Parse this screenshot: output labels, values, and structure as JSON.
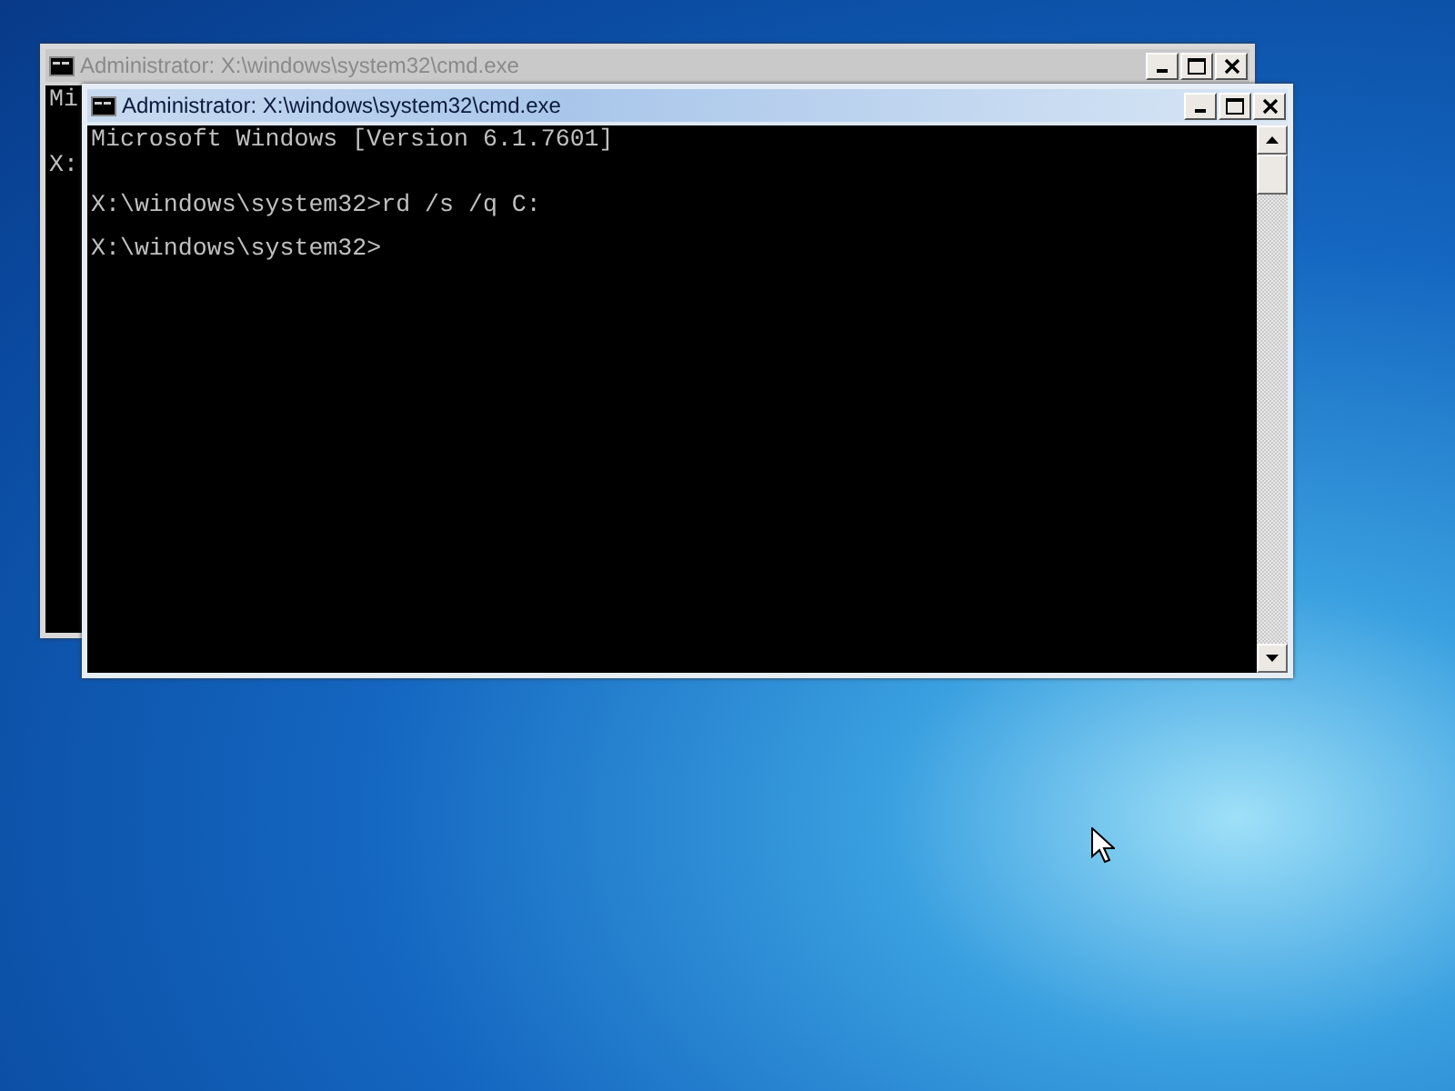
{
  "windows": [
    {
      "title": "Administrator: X:\\windows\\system32\\cmd.exe",
      "active": false,
      "lines": [
        {
          "kind": "text",
          "text": "Mi"
        },
        {
          "kind": "blank"
        },
        {
          "kind": "blank"
        },
        {
          "kind": "text",
          "text": "X:"
        }
      ]
    },
    {
      "title": "Administrator: X:\\windows\\system32\\cmd.exe",
      "active": true,
      "lines": [
        {
          "kind": "text",
          "text": "Microsoft Windows [Version 6.1.7601]"
        },
        {
          "kind": "blank"
        },
        {
          "kind": "blank"
        },
        {
          "kind": "text",
          "text": "X:\\windows\\system32>rd /s /q C:"
        },
        {
          "kind": "blank"
        },
        {
          "kind": "text",
          "text": "X:\\windows\\system32>"
        }
      ]
    }
  ]
}
